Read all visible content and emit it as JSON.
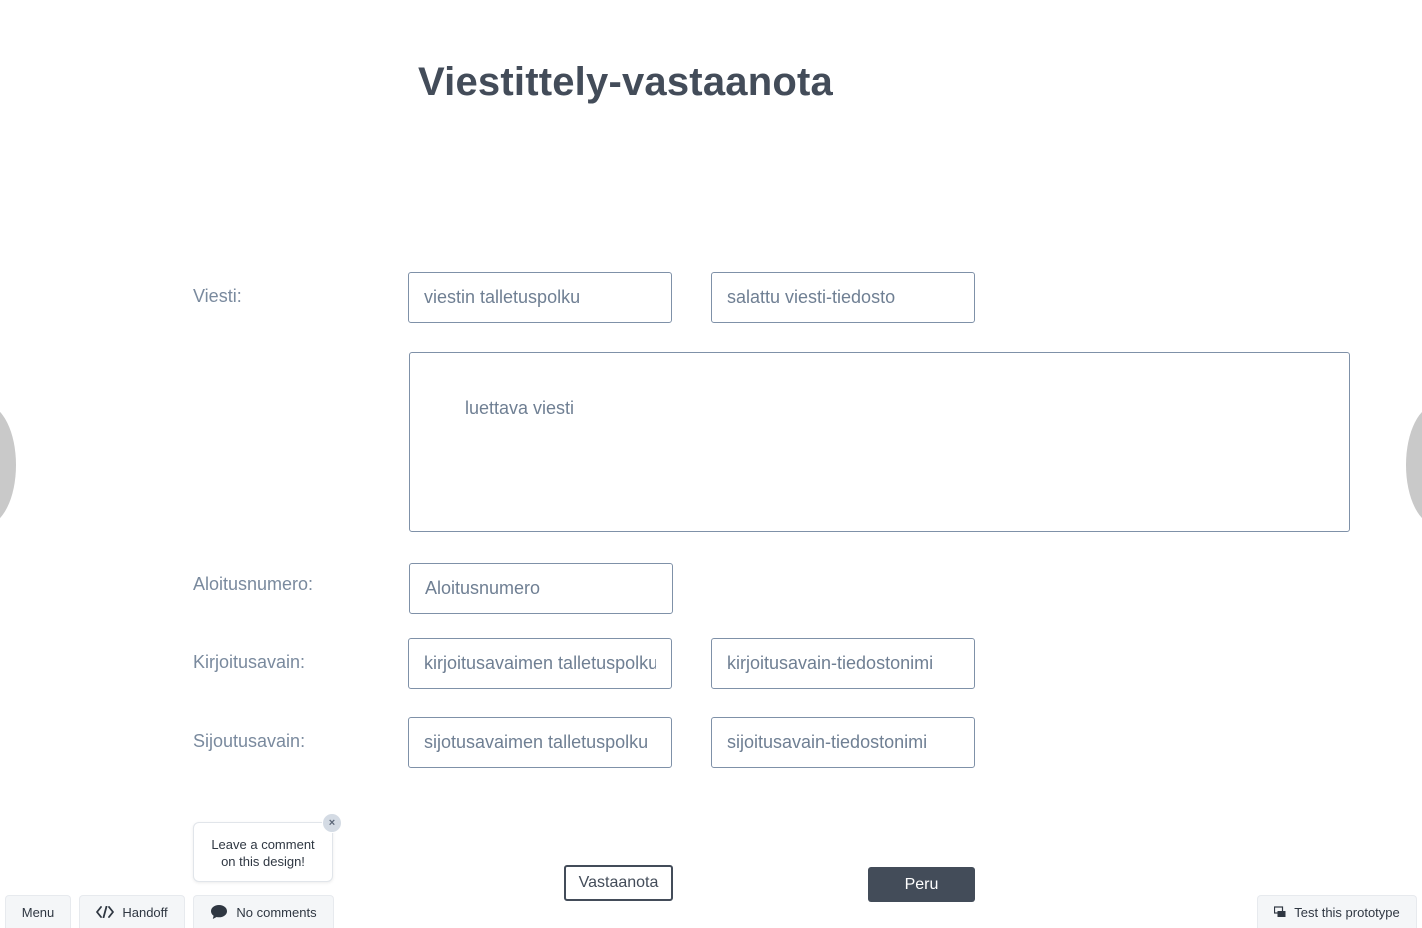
{
  "page": {
    "title": "Viestittely-vastaanota"
  },
  "form": {
    "viesti": {
      "label": "Viesti:",
      "path_placeholder": "viestin talletuspolku",
      "file_placeholder": "salattu viesti-tiedosto",
      "message_placeholder": "luettava viesti"
    },
    "aloitusnumero": {
      "label": "Aloitusnumero:",
      "placeholder": "Aloitusnumero"
    },
    "kirjoitusavain": {
      "label": "Kirjoitusavain:",
      "path_placeholder": "kirjoitusavaimen talletuspolku",
      "file_placeholder": "kirjoitusavain-tiedostonimi"
    },
    "sijoutusavain": {
      "label": "Sijoutusavain:",
      "path_placeholder": "sijotusavaimen talletuspolku",
      "file_placeholder": "sijoitusavain-tiedostonimi"
    }
  },
  "actions": {
    "receive_label": "Vastaanota",
    "cancel_label": "Peru"
  },
  "comment_prompt": {
    "text_line1": "Leave a comment",
    "text_line2": "on this design!",
    "close_glyph": "×"
  },
  "bottom_bar": {
    "menu_label": "Menu",
    "handoff_label": "Handoff",
    "comments_label": "No comments",
    "test_label": "Test this prototype"
  },
  "icons": {
    "handoff": "code-icon",
    "comments": "speech-bubble-icon",
    "test": "prototype-icon"
  },
  "colors": {
    "heading": "#434c59",
    "label": "#7a8a9e",
    "field_border": "#7f91a8",
    "primary_button": "#434c59"
  }
}
